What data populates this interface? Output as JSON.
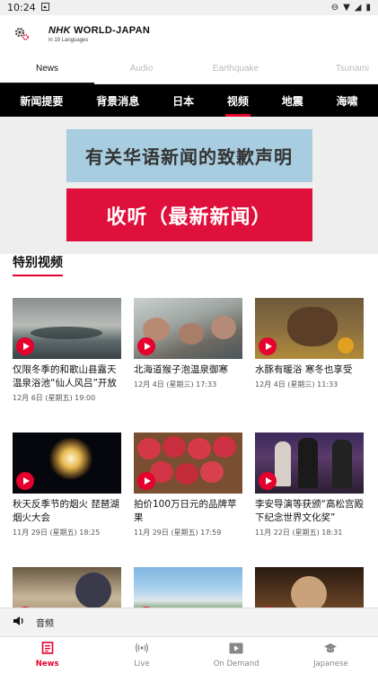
{
  "status": {
    "time": "10:24"
  },
  "brand": {
    "title_bold": "NHK",
    "title_rest": " WORLD-JAPAN",
    "subtitle": "in 19 Languages"
  },
  "tabs": [
    {
      "label": "News"
    },
    {
      "label": "Audio"
    },
    {
      "label": "Earthquake"
    },
    {
      "label": "Tsunami"
    }
  ],
  "categories": [
    {
      "label": "新闻提要"
    },
    {
      "label": "背景消息"
    },
    {
      "label": "日本"
    },
    {
      "label": "视频"
    },
    {
      "label": "地震"
    },
    {
      "label": "海啸"
    }
  ],
  "banners": {
    "apology": "有关华语新闻的致歉声明",
    "listen": "收听（最新新闻）"
  },
  "section": {
    "title": "特别视频"
  },
  "videos": [
    {
      "title": "仅限冬季的和歌山县露天温泉浴池“仙人风吕”开放",
      "date": "12月 6日 (星期五) 19:00"
    },
    {
      "title": "北海道猴子泡温泉御寒",
      "date": "12月 4日 (星期三) 17:33"
    },
    {
      "title": "水豚有暖浴 寒冬也享受",
      "date": "12月 4日 (星期三) 11:33"
    },
    {
      "title": "秋天反季节的烟火 琵琶湖烟火大会",
      "date": "11月 29日 (星期五) 18:25"
    },
    {
      "title": "拍价100万日元的品牌苹果",
      "date": "11月 29日 (星期五) 17:59"
    },
    {
      "title": "李安导演等获颁“高松宫殿下纪念世界文化奖”",
      "date": "11月 22日 (星期五) 18:31"
    },
    {
      "title": "",
      "date": ""
    },
    {
      "title": "",
      "date": ""
    },
    {
      "title": "",
      "date": ""
    }
  ],
  "audio": {
    "label": "音频"
  },
  "nav": [
    {
      "label": "News"
    },
    {
      "label": "Live"
    },
    {
      "label": "On Demand"
    },
    {
      "label": "Japanese"
    }
  ],
  "colors": {
    "accent": "#e6002d",
    "category_bar": "#000000",
    "banner_blue": "#a9cde0"
  }
}
